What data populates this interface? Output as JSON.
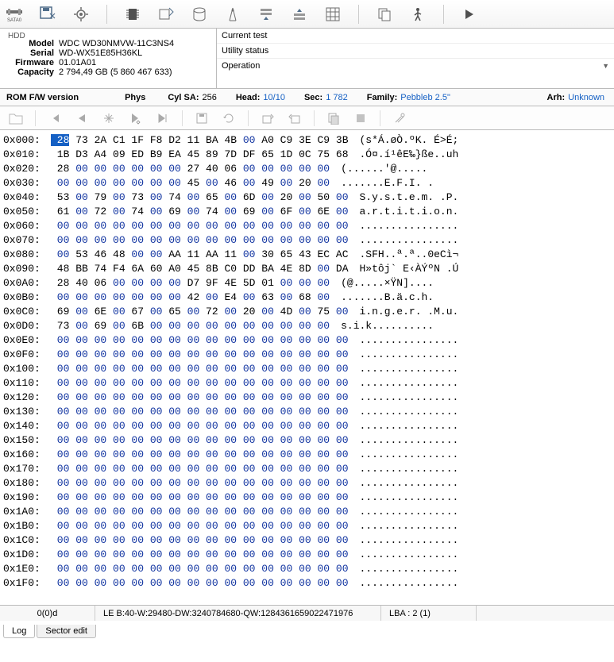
{
  "toolbar_icons": [
    "sata",
    "save",
    "gear",
    "chip",
    "disk-in",
    "cylinder",
    "compass",
    "stack-down",
    "stack-up",
    "grid",
    "copy",
    "walk",
    "play"
  ],
  "hdd": {
    "title": "HDD",
    "model_k": "Model",
    "model_v": "WDC WD30NMVW-11C3NS4",
    "serial_k": "Serial",
    "serial_v": "WD-WX51E85H36KL",
    "fw_k": "Firmware",
    "fw_v": "01.01A01",
    "cap_k": "Capacity",
    "cap_v": "2 794,49 GB (5 860 467 633)"
  },
  "ops": {
    "row1": "Current test",
    "row2": "Utility status",
    "row3": "Operation"
  },
  "geom": {
    "rom_k": "ROM F/W version",
    "phys_k": "Phys",
    "cyl_k": "Cyl SA:",
    "cyl_v": "256",
    "head_k": "Head:",
    "head_v": "10/10",
    "sec_k": "Sec:",
    "sec_v": "1 782",
    "fam_k": "Family:",
    "fam_v": "Pebbleb 2.5\"",
    "arh_k": "Arh:",
    "arh_v": "Unknown"
  },
  "hex": {
    "offset_prefix": "0x",
    "rows": [
      {
        "off": "000",
        "hex": "28 73 2A C1 1F F8 D2 11 BA 4B 00 A0 C9 3E C9 3B",
        "asc": "(s*Á.øÒ.ºK. É>É;"
      },
      {
        "off": "010",
        "hex": "1B D3 A4 09 ED B9 EA 45 89 7D DF 65 1D 0C 75 68",
        "asc": ".Ó¤.í¹êE‰}ße..uh"
      },
      {
        "off": "020",
        "hex": "28 00 00 00 00 00 00 27 40 06 00 00 00 00 00",
        "asc": "(......'@....."
      },
      {
        "off": "030",
        "hex": "00 00 00 00 00 00 00 45 00 46 00 49 00 20 00",
        "asc": ".......E.F.I. ."
      },
      {
        "off": "040",
        "hex": "53 00 79 00 73 00 74 00 65 00 6D 00 20 00 50 00",
        "asc": "S.y.s.t.e.m. .P."
      },
      {
        "off": "050",
        "hex": "61 00 72 00 74 00 69 00 74 00 69 00 6F 00 6E 00",
        "asc": "a.r.t.i.t.i.o.n."
      },
      {
        "off": "060",
        "hex": "00 00 00 00 00 00 00 00 00 00 00 00 00 00 00 00",
        "asc": "................"
      },
      {
        "off": "070",
        "hex": "00 00 00 00 00 00 00 00 00 00 00 00 00 00 00 00",
        "asc": "................"
      },
      {
        "off": "080",
        "hex": "00 53 46 48 00 00 AA 11 AA 11 00 30 65 43 EC AC",
        "asc": ".SFH..ª.ª..0eCì¬"
      },
      {
        "off": "090",
        "hex": "48 BB 74 F4 6A 60 A0 45 8B C0 DD BA 4E 8D 00 DA",
        "asc": "H»tôj` E‹ÀÝºN .Ú"
      },
      {
        "off": "0A0",
        "hex": "28 40 06 00 00 00 00 D7 9F 4E 5D 01 00 00 00",
        "asc": "(@.....×ŸN]...."
      },
      {
        "off": "0B0",
        "hex": "00 00 00 00 00 00 00 42 00 E4 00 63 00 68 00",
        "asc": ".......B.ä.c.h."
      },
      {
        "off": "0C0",
        "hex": "69 00 6E 00 67 00 65 00 72 00 20 00 4D 00 75 00",
        "asc": "i.n.g.e.r. .M.u."
      },
      {
        "off": "0D0",
        "hex": "73 00 69 00 6B 00 00 00 00 00 00 00 00 00 00",
        "asc": "s.i.k.........."
      },
      {
        "off": "0E0",
        "hex": "00 00 00 00 00 00 00 00 00 00 00 00 00 00 00 00",
        "asc": "................"
      },
      {
        "off": "0F0",
        "hex": "00 00 00 00 00 00 00 00 00 00 00 00 00 00 00 00",
        "asc": "................"
      },
      {
        "off": "100",
        "hex": "00 00 00 00 00 00 00 00 00 00 00 00 00 00 00 00",
        "asc": "................"
      },
      {
        "off": "110",
        "hex": "00 00 00 00 00 00 00 00 00 00 00 00 00 00 00 00",
        "asc": "................"
      },
      {
        "off": "120",
        "hex": "00 00 00 00 00 00 00 00 00 00 00 00 00 00 00 00",
        "asc": "................"
      },
      {
        "off": "130",
        "hex": "00 00 00 00 00 00 00 00 00 00 00 00 00 00 00 00",
        "asc": "................"
      },
      {
        "off": "140",
        "hex": "00 00 00 00 00 00 00 00 00 00 00 00 00 00 00 00",
        "asc": "................"
      },
      {
        "off": "150",
        "hex": "00 00 00 00 00 00 00 00 00 00 00 00 00 00 00 00",
        "asc": "................"
      },
      {
        "off": "160",
        "hex": "00 00 00 00 00 00 00 00 00 00 00 00 00 00 00 00",
        "asc": "................"
      },
      {
        "off": "170",
        "hex": "00 00 00 00 00 00 00 00 00 00 00 00 00 00 00 00",
        "asc": "................"
      },
      {
        "off": "180",
        "hex": "00 00 00 00 00 00 00 00 00 00 00 00 00 00 00 00",
        "asc": "................"
      },
      {
        "off": "190",
        "hex": "00 00 00 00 00 00 00 00 00 00 00 00 00 00 00 00",
        "asc": "................"
      },
      {
        "off": "1A0",
        "hex": "00 00 00 00 00 00 00 00 00 00 00 00 00 00 00 00",
        "asc": "................"
      },
      {
        "off": "1B0",
        "hex": "00 00 00 00 00 00 00 00 00 00 00 00 00 00 00 00",
        "asc": "................"
      },
      {
        "off": "1C0",
        "hex": "00 00 00 00 00 00 00 00 00 00 00 00 00 00 00 00",
        "asc": "................"
      },
      {
        "off": "1D0",
        "hex": "00 00 00 00 00 00 00 00 00 00 00 00 00 00 00 00",
        "asc": "................"
      },
      {
        "off": "1E0",
        "hex": "00 00 00 00 00 00 00 00 00 00 00 00 00 00 00 00",
        "asc": "................"
      },
      {
        "off": "1F0",
        "hex": "00 00 00 00 00 00 00 00 00 00 00 00 00 00 00 00",
        "asc": "................"
      }
    ]
  },
  "status": {
    "left": "0(0)d",
    "mid": "LE B:40-W:29480-DW:3240784680-QW:1284361659022471976",
    "lba": "LBA : 2 (1)"
  },
  "tabs": {
    "log": "Log",
    "sector": "Sector edit"
  }
}
